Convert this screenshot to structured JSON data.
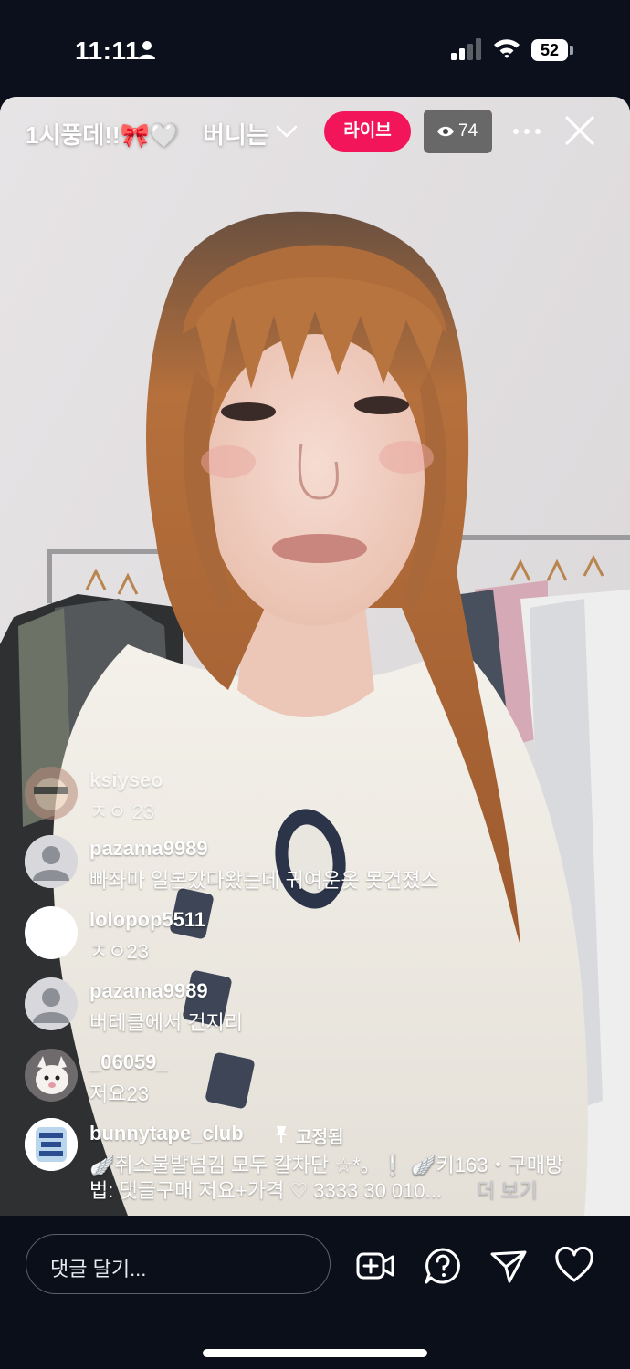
{
  "status_bar": {
    "time": "11:11",
    "battery": "52"
  },
  "header": {
    "title": "1시풍데!!🎀🤍",
    "broadcaster": "버니는",
    "live_label": "라이브",
    "viewer_count": "74"
  },
  "comments": [
    {
      "username": "ksiyseo",
      "message": "ㅈㅇ 23"
    },
    {
      "username": "pazama9989",
      "message": "빠좌마 일본갔다왔는데 귀여운옷 못건졌스"
    },
    {
      "username": "lolopop5511",
      "message": "ㅈㅇ23"
    },
    {
      "username": "pazama9989",
      "message": "버테클에서 건지리"
    },
    {
      "username": "_06059_",
      "message": "저요23"
    }
  ],
  "pinned": {
    "username": "bunnytape_club",
    "pin_label": "고정됨",
    "line1": "🪽취소불발넘김 모두 칼차단 ☆*。❕ 🪽키163・구매방",
    "line2": "법: 댓글구매 저요+가격 ♡ 3333 30 010...",
    "more": "더 보기",
    "avatar_text": "BUNNY TAPE CLUB"
  },
  "composer": {
    "placeholder": "댓글 달기..."
  },
  "colors": {
    "live": "#f2155a",
    "background": "#0b0f1a"
  }
}
